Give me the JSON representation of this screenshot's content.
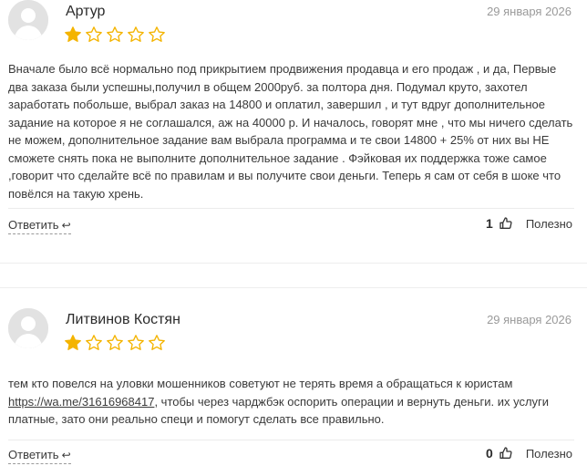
{
  "reviews": [
    {
      "author": "Артур",
      "date": "29 января 2026",
      "rating": 1,
      "max_rating": 5,
      "text": "Вначале было всё нормально под прикрытием продвижения продавца и его продаж , и да, Первые два заказа были успешны,получил в общем 2000руб. за полтора дня. Подумал круто, захотел заработать побольше, выбрал заказ на 14800 и оплатил, завершил , и тут вдруг дополнительное задание на которое я не соглашался, аж на 40000 р. И началось, говорят мне , что мы ничего сделать не можем, дополнительное задание вам выбрала программа и те свои 14800 + 25% от них вы НЕ сможете снять пока не выполните дополнительное задание . Фэйковая их поддержка тоже самое ,говорит что сделайте всё по правилам и вы получите свои деньги. Теперь я сам от себя в шоке что повёлся на такую хрень.",
      "reply_label": "Ответить",
      "useful_count": "1",
      "useful_label": "Полезно"
    },
    {
      "author": "Литвинов Костян",
      "date": "29 января 2026",
      "rating": 1,
      "max_rating": 5,
      "text_before_link": "тем кто повелся на уловки мошенников советуют не терять время а обращаться к юристам ",
      "link": "https://wa.me/31616968417",
      "text_after_link": ", чтобы через чарджбэк оспорить операции и вернуть деньги. их услуги платные, зато они реально специ и помогут сделать все правильно.",
      "reply_label": "Ответить",
      "useful_count": "0",
      "useful_label": "Полезно"
    }
  ],
  "colors": {
    "star_filled": "#f4b400",
    "star_empty": "#f4b400",
    "date": "#9a9a9a",
    "text": "#3a3a3a"
  },
  "icons": {
    "reply": "reply-arrow-icon",
    "useful": "thumbs-up-icon",
    "avatar": "user-avatar-icon",
    "star": "star-icon"
  }
}
